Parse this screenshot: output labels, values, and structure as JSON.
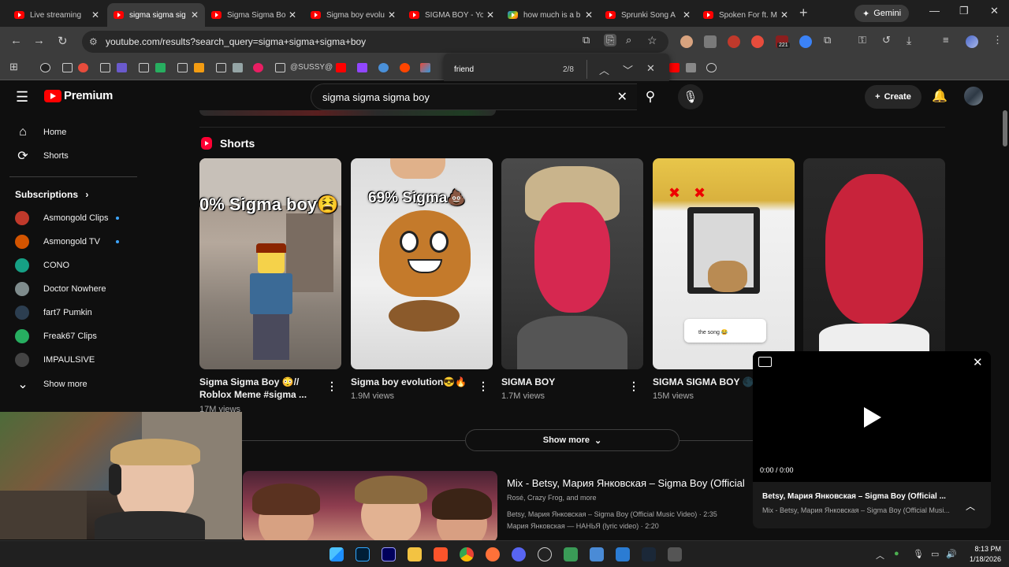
{
  "browser": {
    "tabs": [
      {
        "title": "Live streaming",
        "icon": "youtube-icon",
        "active": false
      },
      {
        "title": "sigma sigma sig",
        "icon": "youtube-icon",
        "active": true
      },
      {
        "title": "Sigma Sigma Bo",
        "icon": "youtube-icon",
        "active": false
      },
      {
        "title": "Sigma boy evolu",
        "icon": "youtube-icon",
        "active": false
      },
      {
        "title": "SIGMA BOY - Yo",
        "icon": "youtube-icon",
        "active": false
      },
      {
        "title": "how much is a b",
        "icon": "google-icon",
        "active": false
      },
      {
        "title": "Sprunki Song A",
        "icon": "youtube-icon",
        "active": false
      },
      {
        "title": "Spoken For ft. M",
        "icon": "youtube-icon",
        "active": false
      }
    ],
    "new_tab": "+",
    "gemini_label": "Gemini",
    "url": "youtube.com/results?search_query=sigma+sigma+sigma+boy",
    "bookmarks": {
      "folder_label": "@SUSSY@",
      "extension_badge": "221"
    },
    "find": {
      "query": "friend",
      "count": "2/8"
    }
  },
  "youtube": {
    "logo_text": "Premium",
    "search_query": "sigma sigma sigma boy",
    "create_label": "Create",
    "sidebar": {
      "main": [
        {
          "label": "Home",
          "icon": "home-icon"
        },
        {
          "label": "Shorts",
          "icon": "shorts-icon"
        }
      ],
      "subscriptions_label": "Subscriptions",
      "subscriptions": [
        {
          "label": "Asmongold Clips",
          "new": true,
          "color": "#c0392b"
        },
        {
          "label": "Asmongold TV",
          "new": true,
          "color": "#d35400"
        },
        {
          "label": "CONO",
          "new": false,
          "color": "#16a085"
        },
        {
          "label": "Doctor Nowhere",
          "new": false,
          "color": "#7f8c8d"
        },
        {
          "label": "fart7 Pumkin",
          "new": false,
          "color": "#2c3e50"
        },
        {
          "label": "Freak67 Clips",
          "new": false,
          "color": "#27ae60"
        },
        {
          "label": "IMPAULSIVE",
          "new": false,
          "color": "#444444"
        }
      ],
      "show_more": "Show more"
    },
    "shorts_heading": "Shorts",
    "shorts": [
      {
        "title": "Sigma Sigma Boy 😳// Roblox Meme #sigma ...",
        "views": "17M views",
        "overlay": "0% Sigma boy😫"
      },
      {
        "title": "Sigma boy evolution😎🔥",
        "views": "1.9M views",
        "overlay": "69% Sigma💩"
      },
      {
        "title": "SIGMA BOY",
        "views": "1.7M views",
        "overlay": ""
      },
      {
        "title": "SIGMA SIGMA BOY 🌑",
        "views": "15M views",
        "overlay": ""
      }
    ],
    "short4_comment": "the song 😂",
    "show_more_label": "Show more",
    "mix": {
      "title": "Mix - Betsy, Мария Янковская – Sigma Boy (Official",
      "channels": "Rosé, Crazy Frog, and more",
      "line1": "Betsy, Мария Янковская – Sigma Boy (Official Music Video) · 2:35",
      "line2": "Мария Янковская — НАНЬЯ (lyric video) · 2:20"
    },
    "miniplayer": {
      "time": "0:00 / 0:00",
      "title": "Betsy, Мария Янковская – Sigma Boy (Official ...",
      "subtitle": "Mix - Betsy, Мария Янковская – Sigma Boy (Official Musi..."
    }
  },
  "taskbar": {
    "time": "8:13 PM",
    "date": "1/18/2026"
  },
  "colors": {
    "youtube_red": "#ff0000",
    "background": "#0f0f0f",
    "accent_blue": "#3ea6ff"
  }
}
